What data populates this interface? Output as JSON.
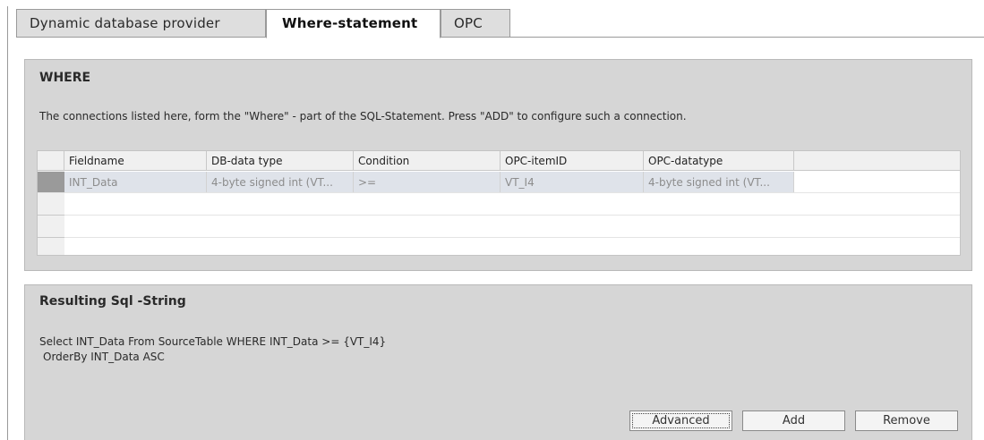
{
  "tabs": [
    {
      "label": "Dynamic database provider",
      "active": false
    },
    {
      "label": "Where-statement",
      "active": true
    },
    {
      "label": "OPC",
      "active": false
    }
  ],
  "where": {
    "title": "WHERE",
    "description": "The connections listed here,  form the \"Where\" - part of the SQL-Statement. Press \"ADD\" to configure such a connection.",
    "columns": [
      "Fieldname",
      "DB-data type",
      "Condition",
      "OPC-itemID",
      "OPC-datatype"
    ],
    "rows": [
      {
        "fieldname": "INT_Data",
        "db_type": "4-byte signed int (VT...",
        "condition": ">=",
        "opc_item_id": "VT_I4",
        "opc_datatype": "4-byte signed int (VT..."
      }
    ]
  },
  "sql": {
    "title": "Resulting Sql -String",
    "line1": "Select INT_Data From SourceTable WHERE INT_Data >= {VT_I4}",
    "line2": "OrderBy INT_Data ASC"
  },
  "buttons": {
    "advanced": "Advanced",
    "add": "Add",
    "remove": "Remove"
  },
  "colors": {
    "panel_bg": "#d6d6d6",
    "selected_row_bg": "#dfe3ea",
    "row_header_selected": "#9a9a9a"
  }
}
